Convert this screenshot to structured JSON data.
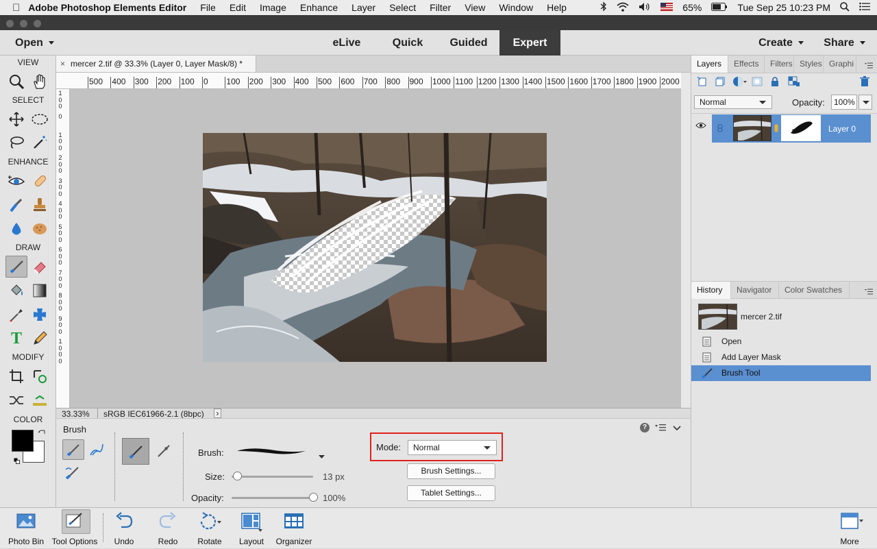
{
  "menubar": {
    "app_name": "Adobe Photoshop Elements Editor",
    "items": [
      "File",
      "Edit",
      "Image",
      "Enhance",
      "Layer",
      "Select",
      "Filter",
      "View",
      "Window",
      "Help"
    ],
    "battery": "65%",
    "datetime": "Tue Sep 25  10:23 PM"
  },
  "modebar": {
    "open_label": "Open",
    "modes": [
      "eLive",
      "Quick",
      "Guided",
      "Expert"
    ],
    "active_mode": "Expert",
    "create_label": "Create",
    "share_label": "Share"
  },
  "toolbox": {
    "sections": [
      "VIEW",
      "SELECT",
      "ENHANCE",
      "DRAW",
      "MODIFY",
      "COLOR"
    ],
    "foreground_color": "#000000",
    "background_color": "#ffffff"
  },
  "document": {
    "tab_title": "mercer 2.tif @ 33.3% (Layer 0, Layer Mask/8) *",
    "close_glyph": "×",
    "ruler_h": [
      "500",
      "400",
      "300",
      "200",
      "100",
      "0",
      "100",
      "200",
      "300",
      "400",
      "500",
      "600",
      "700",
      "800",
      "900",
      "1000",
      "1100",
      "1200",
      "1300",
      "1400",
      "1500",
      "1600",
      "1700",
      "1800",
      "1900",
      "2000"
    ],
    "ruler_v": [
      [
        "1",
        "0",
        "0"
      ],
      [
        "0"
      ],
      [
        "1",
        "0",
        "0"
      ],
      [
        "2",
        "0",
        "0"
      ],
      [
        "3",
        "0",
        "0"
      ],
      [
        "4",
        "0",
        "0"
      ],
      [
        "5",
        "0",
        "0"
      ],
      [
        "6",
        "0",
        "0"
      ],
      [
        "7",
        "0",
        "0"
      ],
      [
        "8",
        "0",
        "0"
      ],
      [
        "9",
        "0",
        "0"
      ],
      [
        "1",
        "0",
        "0",
        "0"
      ]
    ],
    "zoom": "33.33%",
    "color_profile": "sRGB IEC61966-2.1 (8bpc)",
    "status_arrow": "›"
  },
  "layers_panel": {
    "tabs": [
      "Layers",
      "Effects",
      "Filters",
      "Styles",
      "Graphi"
    ],
    "blend_mode": "Normal",
    "opacity_label": "Opacity:",
    "opacity_value": "100%",
    "layer_name": "Layer 0"
  },
  "history_panel": {
    "tabs": [
      "History",
      "Navigator",
      "Color Swatches"
    ],
    "snapshot_name": "mercer 2.tif",
    "items": [
      "Open",
      "Add Layer Mask",
      "Brush Tool"
    ],
    "selected_item": "Brush Tool"
  },
  "tool_options": {
    "tool_name": "Brush",
    "brush_label": "Brush:",
    "size_label": "Size:",
    "size_value": "13 px",
    "size_fraction": 0.03,
    "opacity_label": "Opacity:",
    "opacity_value": "100%",
    "opacity_fraction": 1.0,
    "mode_label": "Mode:",
    "mode_value": "Normal",
    "brush_settings_label": "Brush Settings...",
    "tablet_settings_label": "Tablet Settings...",
    "highlight_color": "#e0201c"
  },
  "bottombar": {
    "items": [
      "Photo Bin",
      "Tool Options",
      "Undo",
      "Redo",
      "Rotate",
      "Layout",
      "Organizer"
    ],
    "more_label": "More"
  }
}
